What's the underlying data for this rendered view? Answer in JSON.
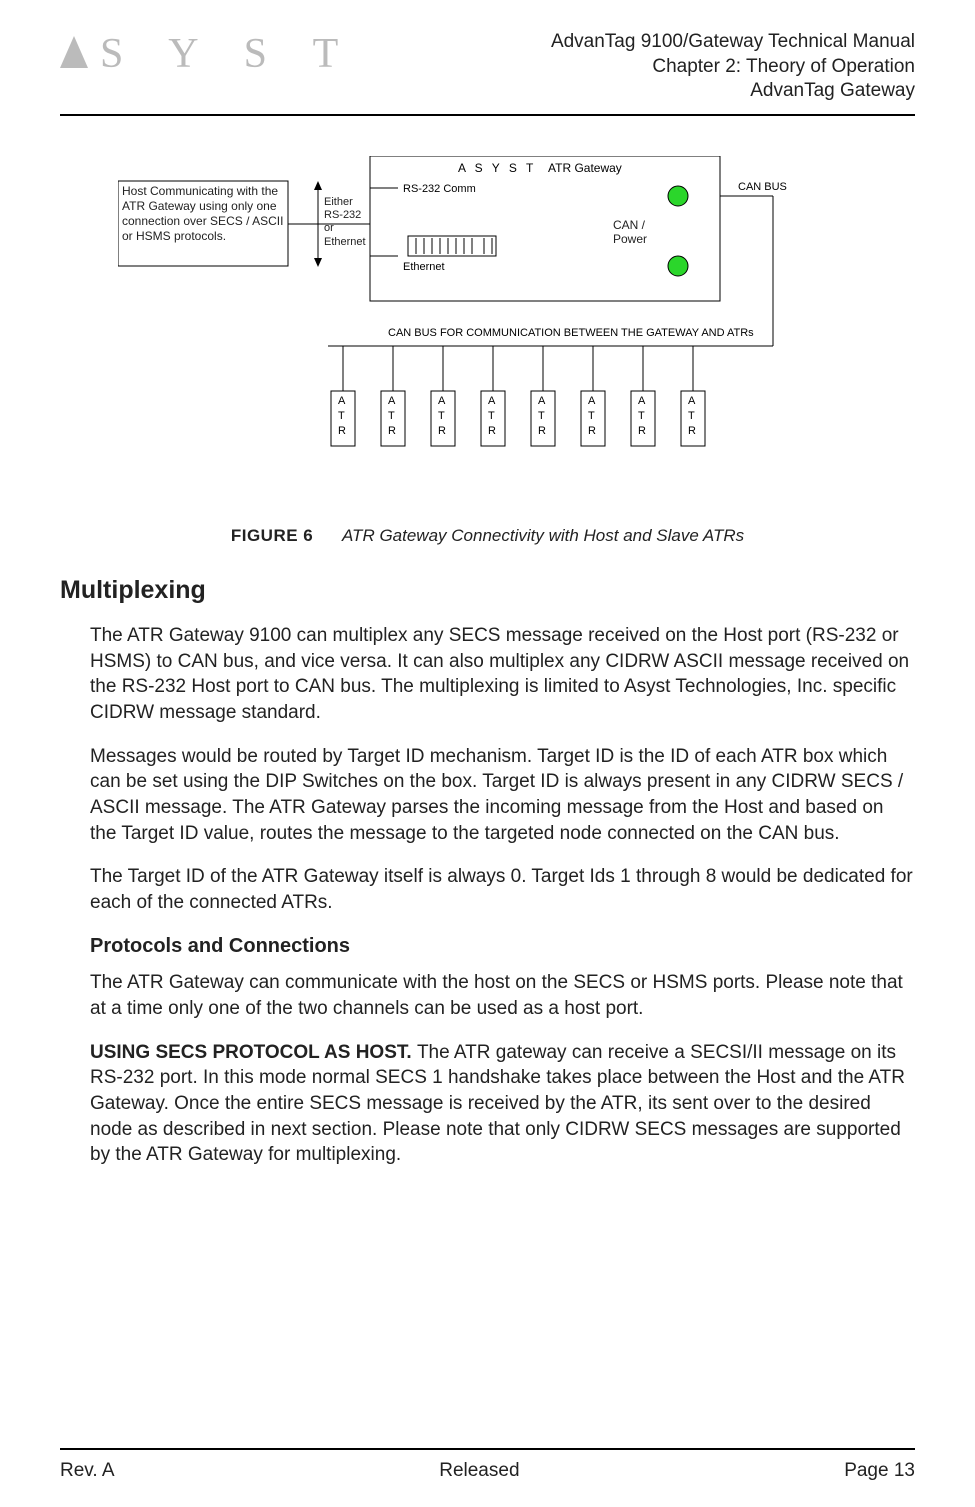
{
  "header": {
    "logo_text": "S Y S T",
    "line1": "AdvanTag 9100/Gateway Technical Manual",
    "line2": "Chapter 2: Theory of Operation",
    "line3": "AdvanTag Gateway"
  },
  "figure": {
    "label": "FIGURE 6",
    "title": "ATR Gateway Connectivity with Host and Slave ATRs",
    "host_box": "Host Communicating with the ATR Gateway using only one connection over SECS / ASCII or HSMS protocols.",
    "conn_label": "Either RS-232 or Ethernet",
    "gateway_brand": "A S Y S T",
    "gateway_label": "ATR Gateway",
    "rs232": "RS-232 Comm",
    "ethernet": "Ethernet",
    "can_power": "CAN / Power",
    "can_bus": "CAN BUS",
    "bus_caption": "CAN BUS FOR COMMUNICATION BETWEEN THE GATEWAY AND ATRs",
    "atr": "ATR"
  },
  "section_heading": "Multiplexing",
  "para1": "The ATR Gateway 9100 can multiplex any SECS message received on the Host port (RS-232 or HSMS) to CAN bus, and vice versa. It can also multiplex any CIDRW ASCII message received on the RS-232 Host port to CAN bus. The multiplexing is limited to Asyst Technologies, Inc. specific CIDRW message standard.",
  "para2": "Messages would be routed by Target ID mechanism. Target ID is the ID of each ATR box which can be set using the DIP Switches on the box. Target ID is always present in any CIDRW SECS / ASCII message. The ATR Gateway parses the incoming message from the Host and based on the Target ID value, routes the message to the targeted node connected on the CAN bus.",
  "para3": "The Target ID of the ATR Gateway itself is always 0. Target Ids 1 through 8 would be dedicated for each of the connected ATRs.",
  "subsection_heading": "Protocols and Connections",
  "para4": "The ATR Gateway can communicate with the host on the SECS or HSMS ports. Please note that at a time only one of the two channels can be used as a host port.",
  "para5_runin": "USING SECS PROTOCOL AS HOST. ",
  "para5_body": "The ATR gateway can receive a SECSI/II message on its RS-232 port. In this mode normal SECS 1 handshake takes place between the Host and the ATR Gateway. Once the entire SECS message is received by the ATR, its sent over to the desired node as described in next section. Please note that only CIDRW SECS messages are supported by the ATR Gateway for multiplexing.",
  "footer": {
    "left": "Rev. A",
    "center": "Released",
    "right": "Page 13"
  }
}
